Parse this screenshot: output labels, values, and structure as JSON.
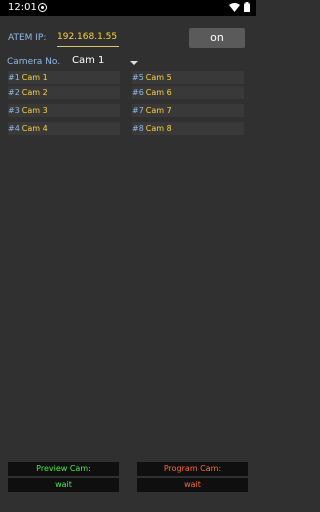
{
  "status_bar": {
    "time": "12:01",
    "icons": [
      "app-circle-icon",
      "wifi-icon",
      "battery-icon"
    ]
  },
  "settings": {
    "atem_label": "ATEM IP:",
    "atem_ip": "192.168.1.55",
    "power_button": "on",
    "camera_label": "Camera No.",
    "camera_selected": "Cam 1"
  },
  "cameras": [
    {
      "num": "#1",
      "name": "Cam 1"
    },
    {
      "num": "#2",
      "name": "Cam 2"
    },
    {
      "num": "#3",
      "name": "Cam 3"
    },
    {
      "num": "#4",
      "name": "Cam 4"
    },
    {
      "num": "#5",
      "name": "Cam 5"
    },
    {
      "num": "#6",
      "name": "Cam 6"
    },
    {
      "num": "#7",
      "name": "Cam 7"
    },
    {
      "num": "#8",
      "name": "Cam 8"
    }
  ],
  "preview": {
    "label": "Preview Cam:",
    "value": "wait"
  },
  "program": {
    "label": "Program Cam:",
    "value": "wait"
  },
  "colors": {
    "background": "#303030",
    "label_blue": "#90b8e8",
    "value_yellow": "#ffd23a",
    "preview_green": "#42f042",
    "program_orange": "#ff6a2a"
  }
}
